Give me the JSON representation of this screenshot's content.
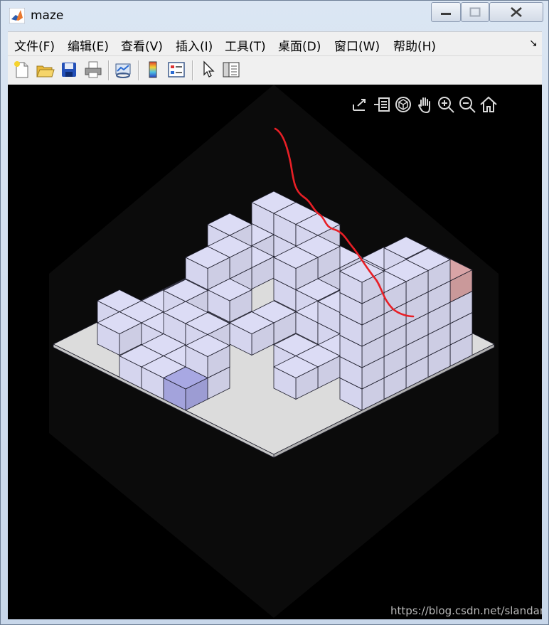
{
  "window": {
    "title": "maze"
  },
  "menu": {
    "items": [
      {
        "label": "文件(F)"
      },
      {
        "label": "编辑(E)"
      },
      {
        "label": "查看(V)"
      },
      {
        "label": "插入(I)"
      },
      {
        "label": "工具(T)"
      },
      {
        "label": "桌面(D)"
      },
      {
        "label": "窗口(W)"
      },
      {
        "label": "帮助(H)"
      }
    ],
    "dock_arrow": "↘"
  },
  "toolbar": {
    "icons": [
      "new-figure-icon",
      "open-file-icon",
      "save-icon",
      "print-icon",
      "link-plot-icon",
      "colorbar-icon",
      "legend-icon",
      "pointer-icon",
      "property-inspector-icon"
    ]
  },
  "axes_toolbar": {
    "icons": [
      "export-icon",
      "brush-icon",
      "rotate-3d-icon",
      "pan-icon",
      "zoom-in-icon",
      "zoom-out-icon",
      "home-icon"
    ]
  },
  "watermark": "https://blog.csdn.net/slandarer",
  "colors": {
    "figure_background": "#000000",
    "cube_face": "#dcdcf5",
    "start_cube": "#d9a4a6",
    "end_cube": "#a8a8e3",
    "path": "#e81f26",
    "floor": "#dcdcdc"
  }
}
